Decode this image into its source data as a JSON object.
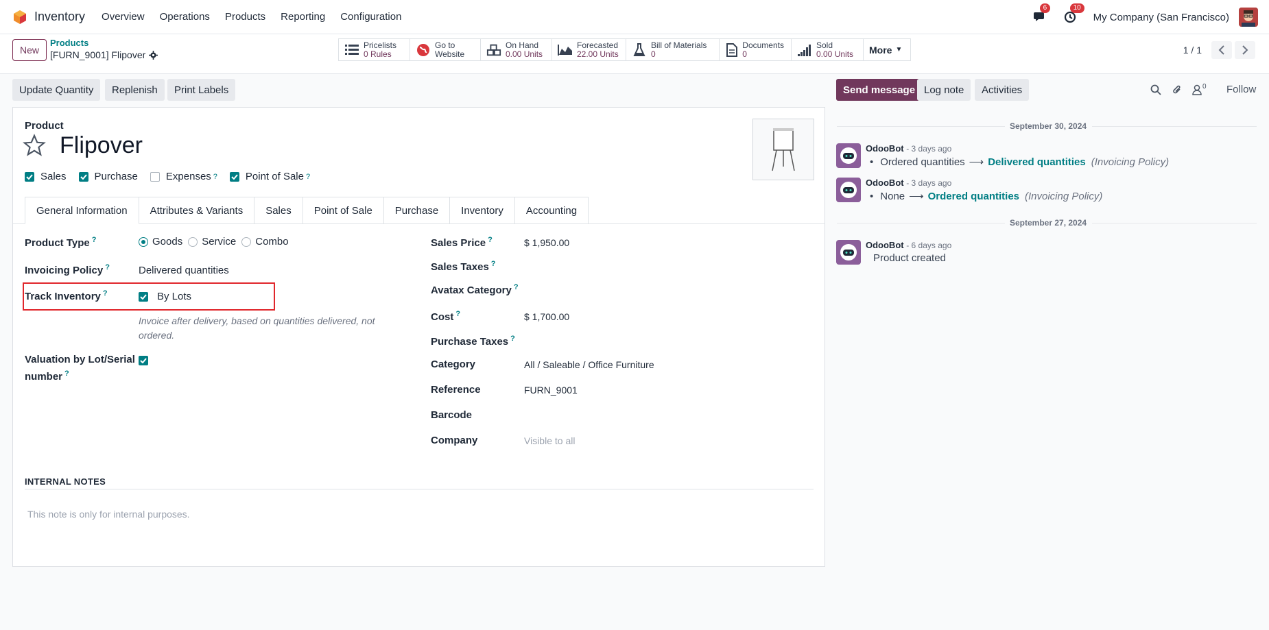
{
  "navbar": {
    "app_name": "Inventory",
    "menu": [
      "Overview",
      "Operations",
      "Products",
      "Reporting",
      "Configuration"
    ],
    "messages_badge": "6",
    "activities_badge": "10",
    "company": "My Company (San Francisco)"
  },
  "control_panel": {
    "new_label": "New",
    "breadcrumb_parent": "Products",
    "breadcrumb_current": "[FURN_9001] Flipover",
    "smart_buttons": [
      {
        "icon": "list-icon",
        "label": "Pricelists",
        "value": "0 Rules"
      },
      {
        "icon": "globe-icon",
        "label": "Go to",
        "value": "Website"
      },
      {
        "icon": "cubes-icon",
        "label": "On Hand",
        "value": "0.00 Units"
      },
      {
        "icon": "area-chart-icon",
        "label": "Forecasted",
        "value": "22.00 Units"
      },
      {
        "icon": "flask-icon",
        "label": "Bill of Materials",
        "value": "0"
      },
      {
        "icon": "document-icon",
        "label": "Documents",
        "value": "0"
      },
      {
        "icon": "signal-icon",
        "label": "Sold",
        "value": "0.00 Units"
      }
    ],
    "more_label": "More",
    "pager": "1 / 1"
  },
  "actions": [
    "Update Quantity",
    "Replenish",
    "Print Labels"
  ],
  "form": {
    "product_label": "Product",
    "name": "Flipover",
    "checkboxes": [
      {
        "label": "Sales",
        "checked": true
      },
      {
        "label": "Purchase",
        "checked": true
      },
      {
        "label": "Expenses",
        "checked": false
      },
      {
        "label": "Point of Sale",
        "checked": true
      }
    ],
    "tabs": [
      "General Information",
      "Attributes & Variants",
      "Sales",
      "Point of Sale",
      "Purchase",
      "Inventory",
      "Accounting"
    ],
    "left": {
      "product_type_label": "Product Type",
      "product_type_options": [
        "Goods",
        "Service",
        "Combo"
      ],
      "product_type_selected": "Goods",
      "invoicing_policy_label": "Invoicing Policy",
      "invoicing_policy_value": "Delivered quantities",
      "track_inventory_label": "Track Inventory",
      "track_inventory_value": "By Lots",
      "help_text": "Invoice after delivery, based on quantities delivered, not ordered.",
      "valuation_label_1": "Valuation by Lot/Serial",
      "valuation_label_2": "number"
    },
    "right": {
      "sales_price_label": "Sales Price",
      "sales_price_value": "$ 1,950.00",
      "sales_taxes_label": "Sales Taxes",
      "avatax_label": "Avatax Category",
      "cost_label": "Cost",
      "cost_value": "$ 1,700.00",
      "purchase_taxes_label": "Purchase Taxes",
      "category_label": "Category",
      "category_value": "All / Saleable / Office Furniture",
      "reference_label": "Reference",
      "reference_value": "FURN_9001",
      "barcode_label": "Barcode",
      "company_label": "Company",
      "company_value": "Visible to all"
    },
    "notes_header": "INTERNAL NOTES",
    "notes_placeholder": "This note is only for internal purposes."
  },
  "chatter": {
    "send_message": "Send message",
    "log_note": "Log note",
    "activities": "Activities",
    "followers_count": "0",
    "follow": "Follow",
    "date1": "September 30, 2024",
    "date2": "September 27, 2024",
    "messages": [
      {
        "author": "OdooBot",
        "time": "- 3 days ago",
        "old": "Ordered quantities",
        "new": "Delivered quantities",
        "field": "(Invoicing Policy)"
      },
      {
        "author": "OdooBot",
        "time": "- 3 days ago",
        "old": "None",
        "new": "Ordered quantities",
        "field": "(Invoicing Policy)"
      },
      {
        "author": "OdooBot",
        "time": "- 6 days ago",
        "body": "Product created"
      }
    ]
  },
  "colors": {
    "brand": "#71385c",
    "accent": "#017e84",
    "highlight": "#e0262b"
  }
}
